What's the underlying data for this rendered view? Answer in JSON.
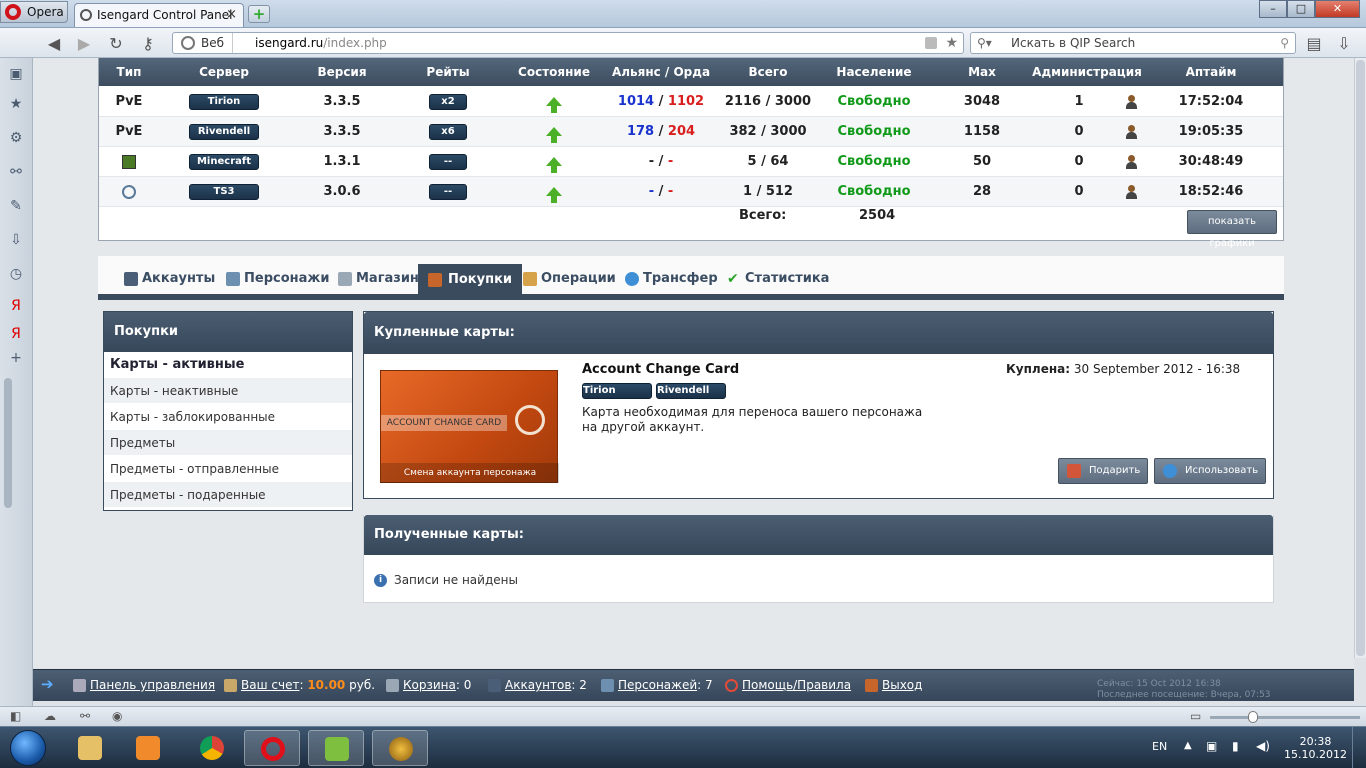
{
  "browser": {
    "opera_label": "Opera",
    "tab_title": "Isengard Control Panel",
    "tab_close": "×",
    "new_tab": "+",
    "web_label": "Веб",
    "url_host": "isengard.ru",
    "url_path": "/index.php",
    "search_placeholder": "Искать в QIP Search",
    "window_controls": [
      "–",
      "□",
      "✕"
    ]
  },
  "servers": {
    "columns": [
      "Тип",
      "Сервер",
      "Версия",
      "Рейты",
      "Состояние",
      "Альянс / Орда",
      "Всего",
      "Население",
      "Max",
      "Администрация",
      "Аптайм"
    ],
    "rows": [
      {
        "type": "PvE",
        "server": "Tirion",
        "version": "3.3.5",
        "rate": "x2",
        "alliance": "1014",
        "horde": "1102",
        "total": "2116 / 3000",
        "population": "Свободно",
        "max": "3048",
        "admin": "1",
        "uptime": "17:52:04",
        "type_icon": "text"
      },
      {
        "type": "PvE",
        "server": "Rivendell",
        "version": "3.3.5",
        "rate": "x6",
        "alliance": "178",
        "horde": "204",
        "total": "382 / 3000",
        "population": "Свободно",
        "max": "1158",
        "admin": "0",
        "uptime": "19:05:35",
        "type_icon": "text"
      },
      {
        "type": "",
        "server": "Minecraft",
        "version": "1.3.1",
        "rate": "--",
        "alliance": "-",
        "horde": "-",
        "total": "5 / 64",
        "population": "Свободно",
        "max": "50",
        "admin": "0",
        "uptime": "30:48:49",
        "type_icon": "minecraft-icon"
      },
      {
        "type": "",
        "server": "TS3",
        "version": "3.0.6",
        "rate": "--",
        "alliance": "-",
        "horde": "-",
        "total": "1 / 512",
        "population": "Свободно",
        "max": "28",
        "admin": "0",
        "uptime": "18:52:46",
        "type_icon": "teamspeak-icon"
      }
    ],
    "totals_label": "Всего:",
    "totals_value": "2504",
    "graph_button": "показать графики"
  },
  "tabs": [
    {
      "label": "Аккаунты",
      "icon": "account-icon",
      "active": false
    },
    {
      "label": "Персонажи",
      "icon": "characters-icon",
      "active": false
    },
    {
      "label": "Магазин",
      "icon": "cart-icon",
      "active": false
    },
    {
      "label": "Покупки",
      "icon": "purchases-icon",
      "active": true
    },
    {
      "label": "Операции",
      "icon": "operations-icon",
      "active": false
    },
    {
      "label": "Трансфер",
      "icon": "transfer-icon",
      "active": false
    },
    {
      "label": "Статистика",
      "icon": "check-icon",
      "active": false
    }
  ],
  "sidemenu": {
    "title": "Покупки",
    "items": [
      "Карты - активные",
      "Карты - неактивные",
      "Карты - заблокированные",
      "Предметы",
      "Предметы - отправленные",
      "Предметы - подаренные"
    ]
  },
  "bought": {
    "title": "Купленные карты:",
    "card_image_label": "ACCOUNT CHANGE CARD",
    "card_image_sub": "Смена аккаунта персонажа",
    "card_name": "Account Change Card",
    "tags": [
      "Tirion",
      "Rivendell"
    ],
    "description": "Карта необходимая для переноса вашего персонажа на другой аккаунт.",
    "bought_label": "Куплена:",
    "bought_date": "30 September 2012 - 16:38",
    "gift_button": "Подарить",
    "use_button": "Использовать"
  },
  "received": {
    "title": "Полученные карты:",
    "empty": "Записи не найдены"
  },
  "bottombar": {
    "panel": "Панель управления",
    "account_label": "Ваш счет",
    "balance": "10.00",
    "currency": "руб.",
    "cart_label": "Корзина",
    "cart_count": "0",
    "accounts_label": "Аккаунтов",
    "accounts_count": "2",
    "chars_label": "Персонажей",
    "chars_count": "7",
    "help": "Помощь/Правила",
    "logout": "Выход",
    "server_time": "Сейчас: 15 Oct 2012 16:38",
    "last_visit": "Последнее посещение: Вчера, 07:53"
  },
  "tray": {
    "lang": "EN",
    "time": "20:38",
    "date": "15.10.2012"
  },
  "colors": {
    "header": "#3d4d5f",
    "alliance": "#1a33cc",
    "horde": "#d91e1e",
    "free": "#119a19",
    "balance": "#ff8c1a"
  }
}
